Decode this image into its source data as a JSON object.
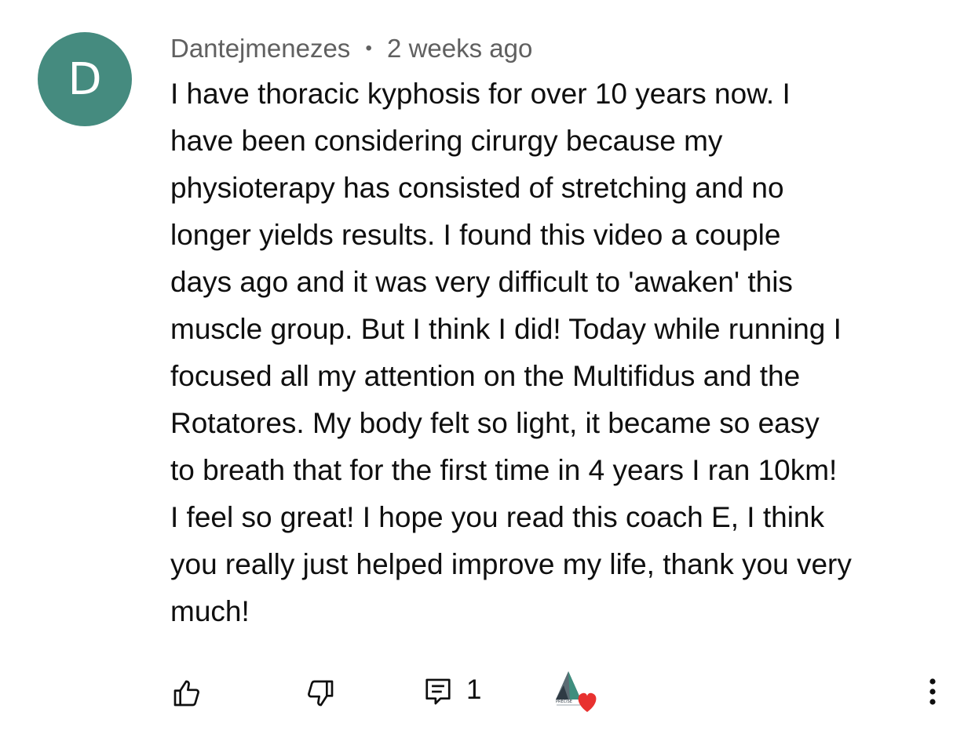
{
  "comment": {
    "avatar_letter": "D",
    "avatar_color": "#458b7f",
    "author": "Dantejmenezes",
    "separator": "•",
    "time_ago": "2 weeks ago",
    "text_lines": [
      "I have thoracic kyphosis for over 10 years now. I",
      "have been considering cirurgy because my",
      "physioterapy has consisted of stretching and no",
      "longer yields results. I found this video a couple",
      "days ago and it was very difficult to 'awaken' this",
      "muscle group. But I think I did! Today while running I",
      "focused all my attention on the Multifidus and the",
      "Rotatores. My body felt so light, it became so easy",
      "to breath that for the first time in 4 years I ran 10km!",
      "I feel so great! I hope you read this coach E, I think",
      "you really just helped improve my life, thank you very",
      "much!"
    ]
  },
  "actions": {
    "like_icon": "thumbs-up-icon",
    "dislike_icon": "thumbs-down-icon",
    "reply_icon": "comment-reply-icon",
    "reply_count": "1",
    "creator_heart_icon": "creator-heart-icon",
    "creator_logo_text": "PRECISE",
    "heart_color": "#e8312f",
    "more_icon": "more-vertical-icon"
  }
}
